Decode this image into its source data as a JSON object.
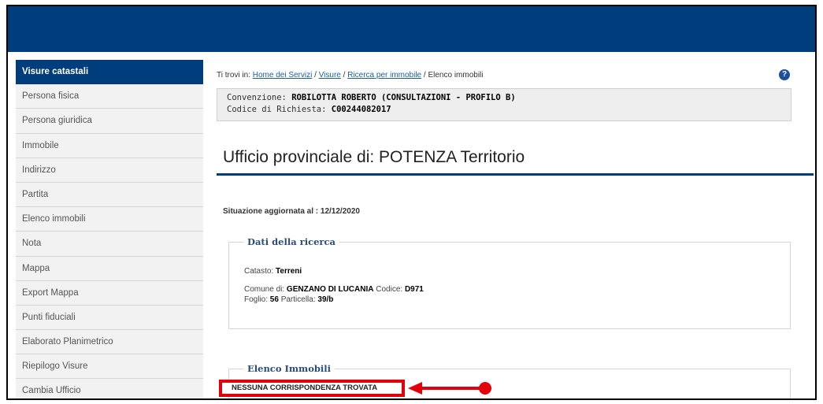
{
  "sidebar": {
    "items": [
      {
        "label": "Visure catastali",
        "active": true
      },
      {
        "label": "Persona fisica"
      },
      {
        "label": "Persona giuridica"
      },
      {
        "label": "Immobile"
      },
      {
        "label": "Indirizzo"
      },
      {
        "label": "Partita"
      },
      {
        "label": "Elenco immobili"
      },
      {
        "label": "Nota"
      },
      {
        "label": "Mappa"
      },
      {
        "label": "Export Mappa"
      },
      {
        "label": "Punti fiduciali"
      },
      {
        "label": "Elaborato Planimetrico"
      },
      {
        "label": "Riepilogo Visure"
      },
      {
        "label": "Cambia Ufficio"
      }
    ]
  },
  "breadcrumb": {
    "prefix": "Ti trovi in: ",
    "links": [
      "Home dei Servizi",
      "Visure",
      "Ricerca per immobile"
    ],
    "separator": " / ",
    "current": "Elenco immobili"
  },
  "help_icon": {
    "glyph": "?",
    "name": "help-icon"
  },
  "convenzione": {
    "label": "Convenzione: ",
    "value": "ROBILOTTA ROBERTO (CONSULTAZIONI - PROFILO B)",
    "codice_label": "Codice di Richiesta: ",
    "codice_value": "C00244082017"
  },
  "office_title": "Ufficio provinciale di: POTENZA Territorio",
  "situazione": "Situazione aggiornata al : 12/12/2020",
  "dati_ricerca": {
    "legend": "Dati della ricerca",
    "catasto_label": "Catasto: ",
    "catasto_value": "Terreni",
    "comune_label": "Comune di: ",
    "comune_value": "GENZANO DI LUCANIA",
    "codice_label": " Codice: ",
    "codice_value": "D971",
    "foglio_label": "Foglio: ",
    "foglio_value": "56",
    "particella_label": " Particella: ",
    "particella_value": "39/b"
  },
  "elenco_immobili": {
    "legend": "Elenco Immobili",
    "message": "NESSUNA CORRISPONDENZA TROVATA"
  },
  "colors": {
    "brand_blue": "#003d7c",
    "highlight_red": "#e3000b"
  }
}
